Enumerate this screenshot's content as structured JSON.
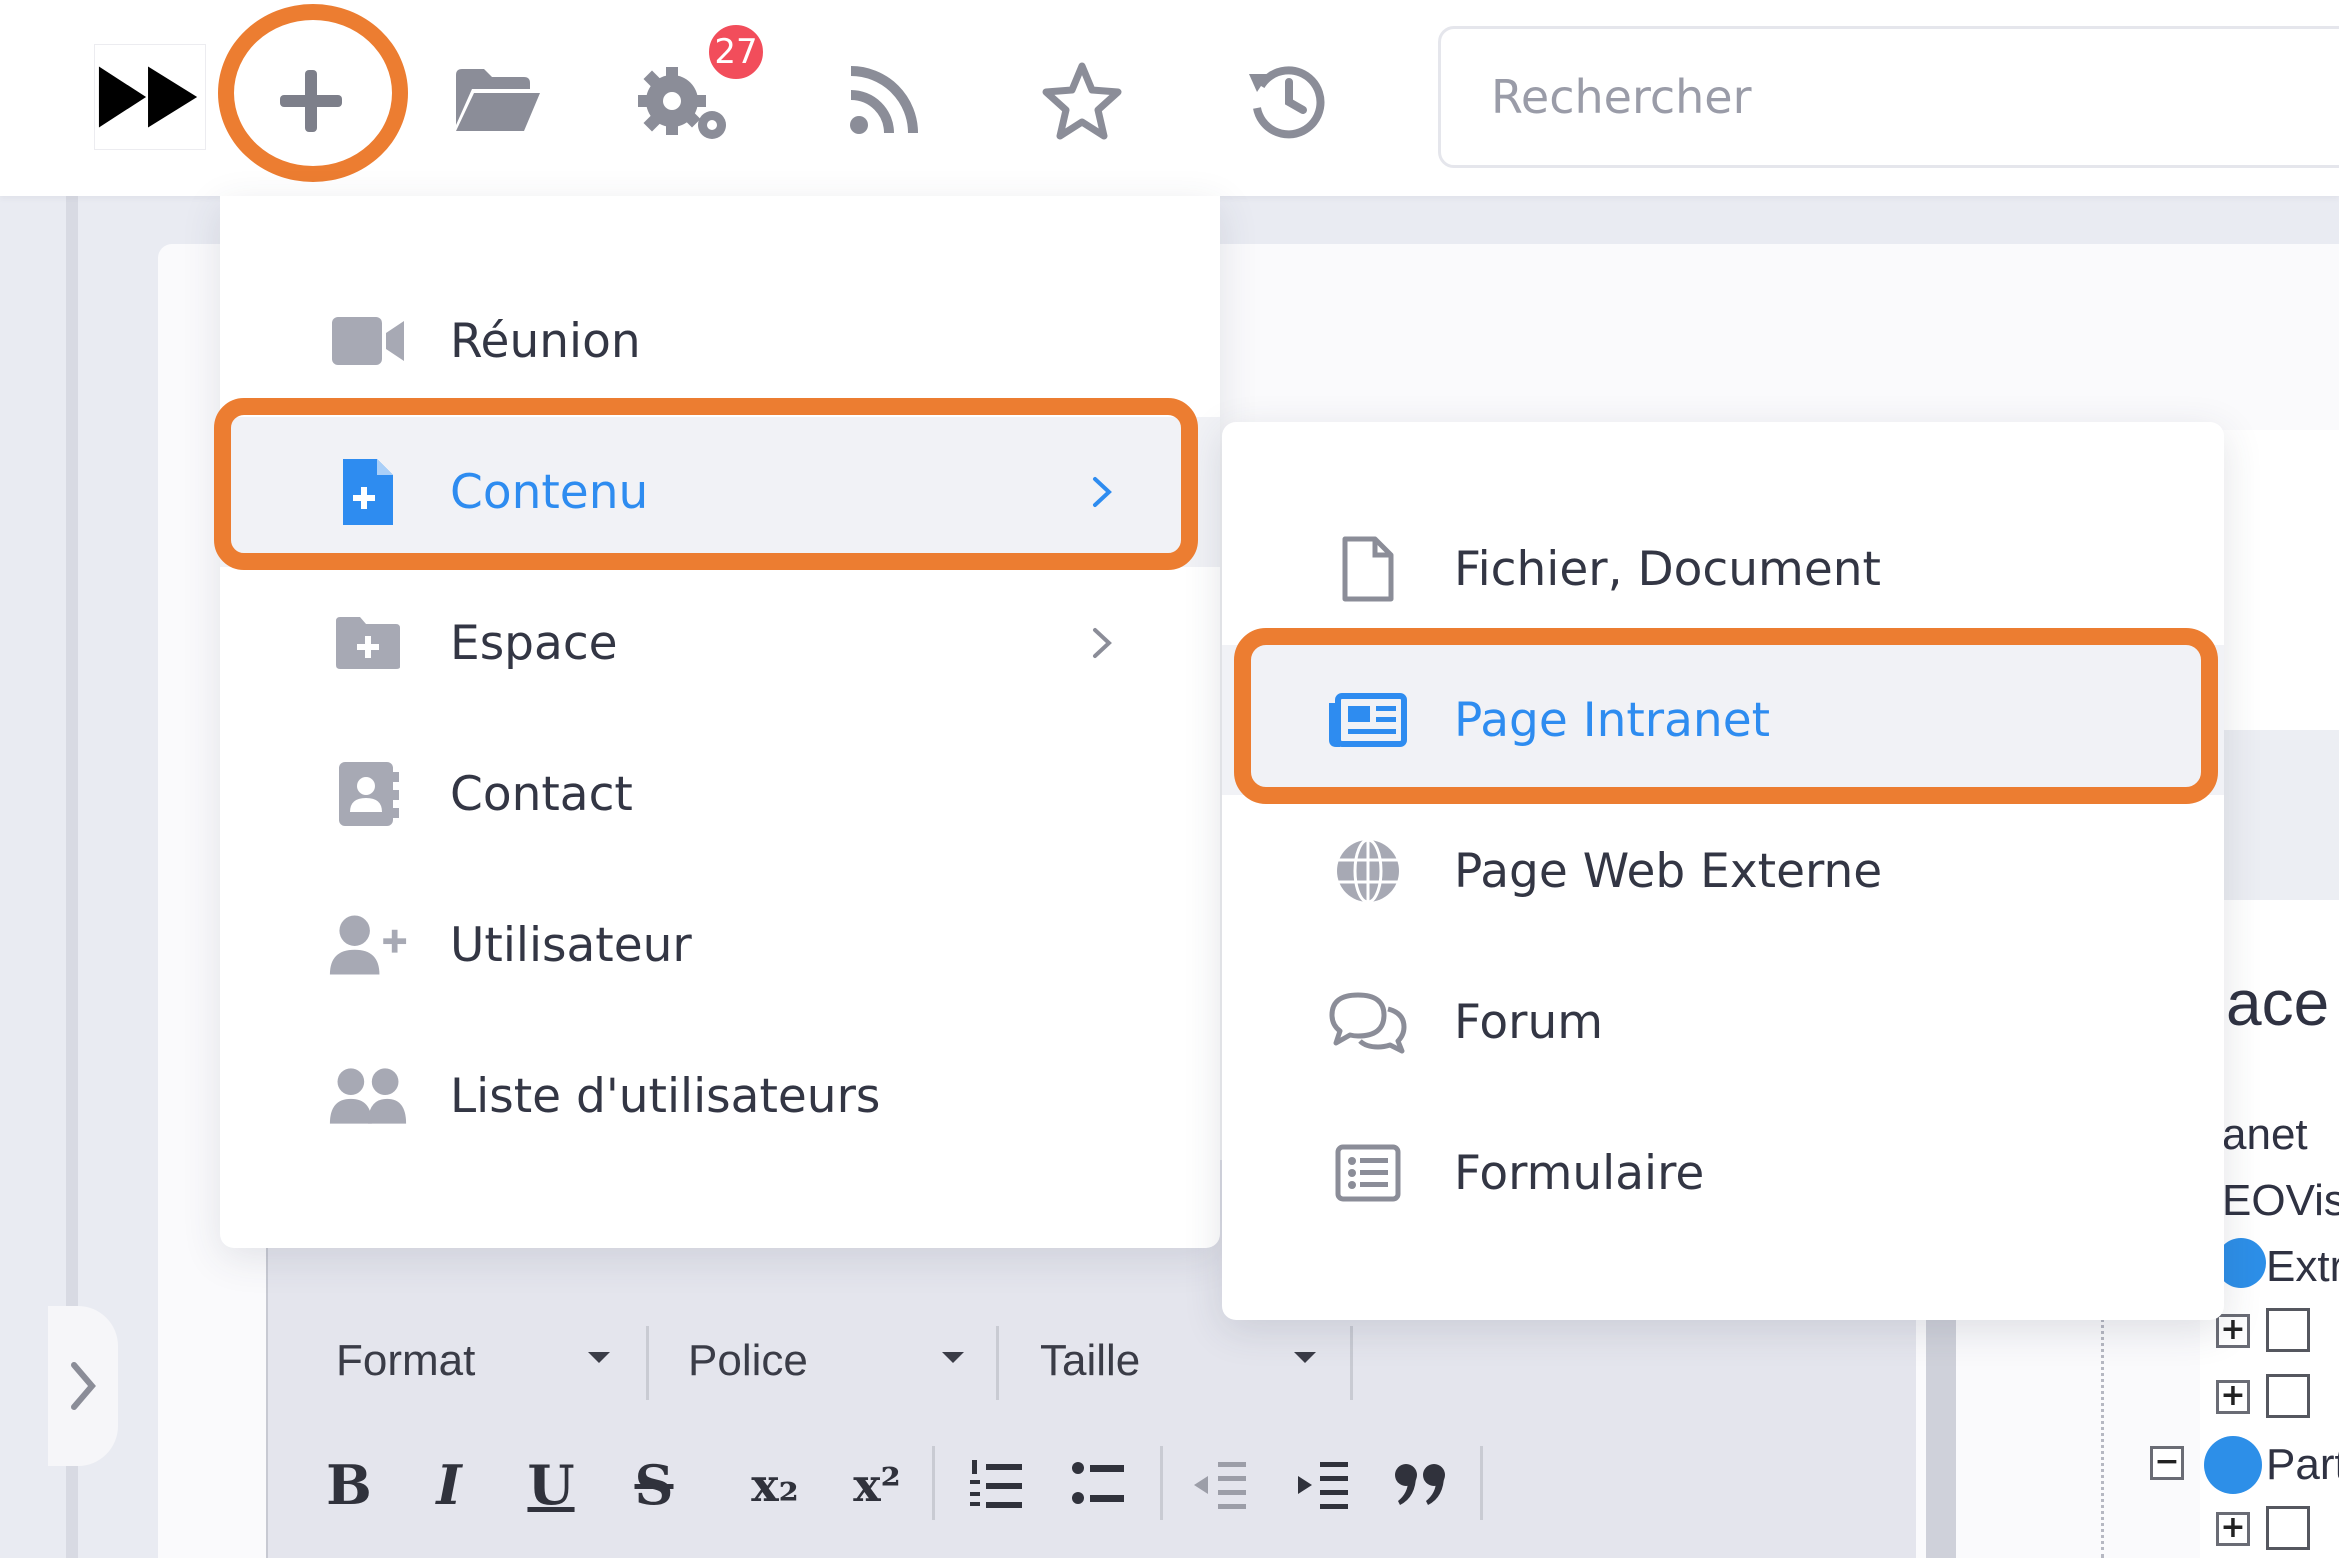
{
  "toolbar": {
    "logo_icon": "fast-forward-icon",
    "notification_count": "27",
    "search_placeholder": "Rechercher",
    "accent_color": "#ec7d31",
    "badge_color": "#f24d5b",
    "icons": [
      "plus-icon",
      "folder-open-icon",
      "gears-icon",
      "rss-icon",
      "star-icon",
      "history-icon"
    ]
  },
  "menu": {
    "items": [
      {
        "label": "Réunion",
        "icon": "video-camera-icon",
        "submenu": false
      },
      {
        "label": "Contenu",
        "icon": "file-plus-icon",
        "submenu": true,
        "active": true
      },
      {
        "label": "Espace",
        "icon": "folder-plus-icon",
        "submenu": true
      },
      {
        "label": "Contact",
        "icon": "address-book-icon",
        "submenu": false
      },
      {
        "label": "Utilisateur",
        "icon": "user-plus-icon",
        "submenu": false
      },
      {
        "label": "Liste d'utilisateurs",
        "icon": "users-icon",
        "submenu": false
      }
    ]
  },
  "submenu": {
    "items": [
      {
        "label": "Fichier, Document",
        "icon": "file-icon"
      },
      {
        "label": "Page Intranet",
        "icon": "newspaper-icon",
        "active": true
      },
      {
        "label": "Page Web Externe",
        "icon": "globe-icon"
      },
      {
        "label": "Forum",
        "icon": "comments-icon"
      },
      {
        "label": "Formulaire",
        "icon": "list-form-icon"
      }
    ]
  },
  "editor": {
    "format_label": "Format",
    "font_label": "Police",
    "size_label": "Taille",
    "buttons": [
      "B",
      "I",
      "U",
      "S",
      "x₂",
      "x²"
    ]
  },
  "tree": {
    "heading_fragment": "ace",
    "line1": "anet",
    "line2": "EOVis",
    "line3": "Extr",
    "line4": "Part"
  }
}
